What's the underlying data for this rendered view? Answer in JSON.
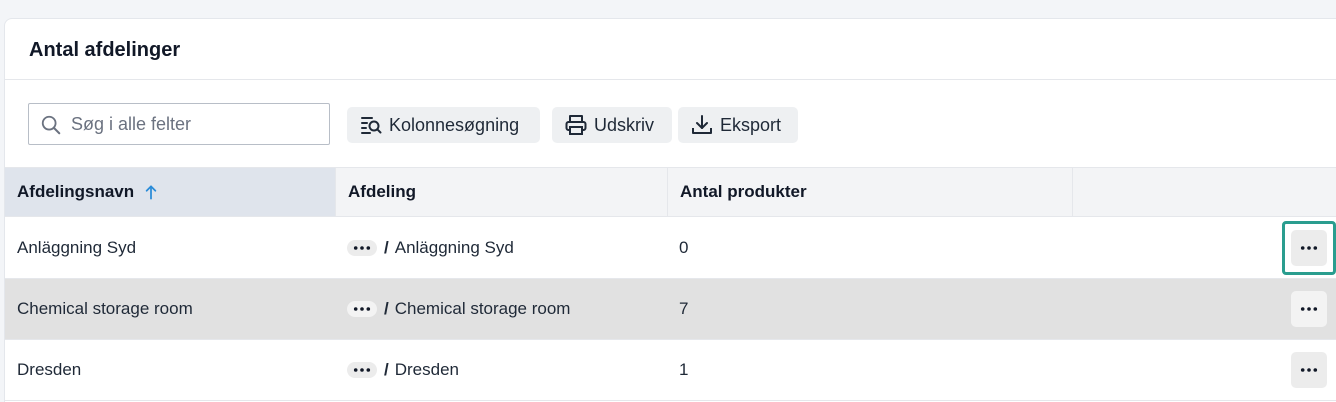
{
  "card": {
    "title": "Antal afdelinger"
  },
  "toolbar": {
    "search_placeholder": "Søg i alle felter",
    "column_search_label": "Kolonnesøgning",
    "print_label": "Udskriv",
    "export_label": "Eksport"
  },
  "table": {
    "columns": [
      "Afdelingsnavn",
      "Afdeling",
      "Antal produkter"
    ],
    "sort": {
      "column": "Afdelingsnavn",
      "direction": "ascending"
    },
    "rows": [
      {
        "name": "Anläggning Syd",
        "path": "Anläggning Syd",
        "count": "0"
      },
      {
        "name": "Chemical storage room",
        "path": "Chemical storage room",
        "count": "7"
      },
      {
        "name": "Dresden",
        "path": "Dresden",
        "count": "1"
      }
    ],
    "path_separator": "/"
  },
  "colors": {
    "accent_sort": "#2a8bd8",
    "focus_ring": "#2a9d8f",
    "sorted_header_bg": "#dfe4ec",
    "alt_row_bg": "#e1e1e1"
  },
  "icons": {
    "search": "search-icon",
    "column_search": "column-search-icon",
    "print": "printer-icon",
    "export": "download-icon",
    "sort": "arrow-up-icon",
    "row_menu": "more-horizontal-icon"
  }
}
